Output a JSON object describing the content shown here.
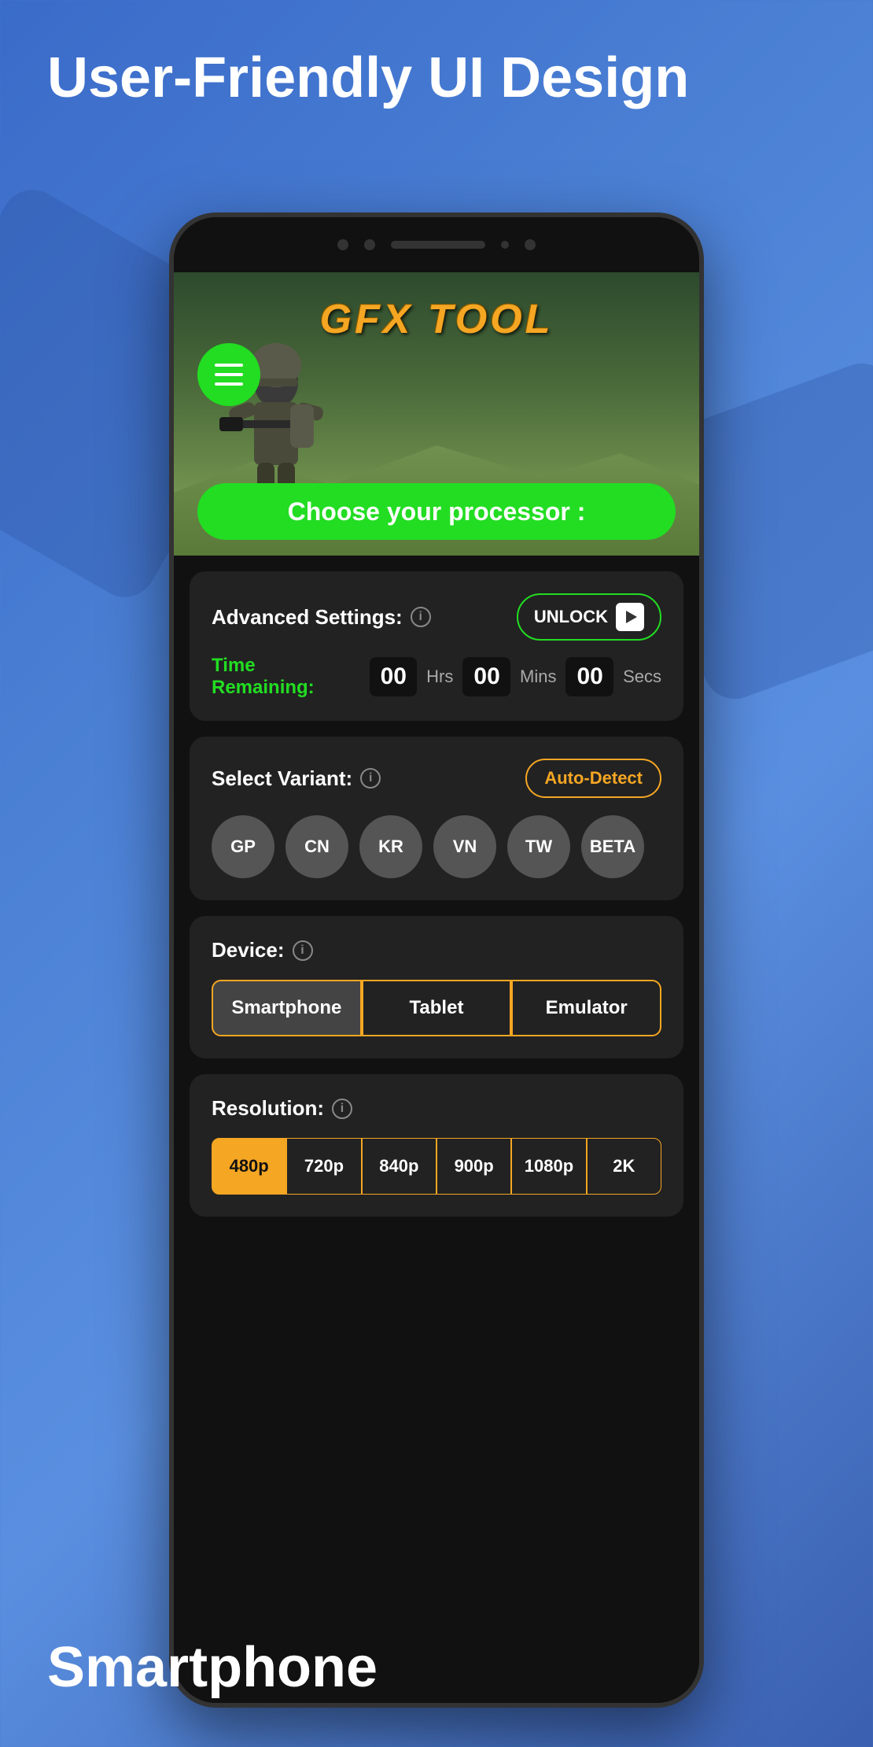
{
  "page": {
    "title": "User-Friendly UI Design",
    "background_color": "#3a6bc9"
  },
  "phone": {
    "gfx_title": "GFX TOOL",
    "menu_button_label": "☰",
    "choose_processor_btn": "Choose your processor :",
    "advanced_settings": {
      "title": "Advanced Settings:",
      "info_icon": "i",
      "unlock_label": "UNLOCK",
      "time_label": "Time Remaining:",
      "hours": "00",
      "hours_unit": "Hrs",
      "mins": "00",
      "mins_unit": "Mins",
      "secs": "00",
      "secs_unit": "Secs"
    },
    "select_variant": {
      "title": "Select Variant:",
      "info_icon": "i",
      "auto_detect_label": "Auto-Detect",
      "buttons": [
        "GP",
        "CN",
        "KR",
        "VN",
        "TW",
        "BETA"
      ]
    },
    "device": {
      "title": "Device:",
      "info_icon": "i",
      "buttons": [
        "Smartphone",
        "Tablet",
        "Emulator"
      ],
      "active": "Smartphone"
    },
    "resolution": {
      "title": "Resolution:",
      "info_icon": "i",
      "buttons": [
        "480p",
        "720p",
        "840p",
        "900p",
        "1080p",
        "2K"
      ],
      "active": "480p"
    }
  },
  "bottom_label": "Smartphone"
}
